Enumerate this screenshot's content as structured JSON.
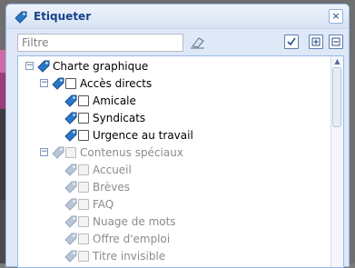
{
  "dialog": {
    "title": "Etiqueter",
    "close_symbol": "×"
  },
  "toolbar": {
    "filter_placeholder": "Filtre",
    "check_all_symbol": "✓",
    "expand_all_symbol": "+",
    "collapse_all_symbol": "−"
  },
  "tree": {
    "nodes": [
      {
        "label": "Charte graphique",
        "level": 0,
        "expander": "−",
        "enabled": true
      },
      {
        "label": "Accès directs",
        "level": 1,
        "expander": "−",
        "enabled": true
      },
      {
        "label": "Amicale",
        "level": 2,
        "enabled": true
      },
      {
        "label": "Syndicats",
        "level": 2,
        "enabled": true
      },
      {
        "label": "Urgence au travail",
        "level": 2,
        "enabled": true
      },
      {
        "label": "Contenus spéciaux",
        "level": 1,
        "expander": "−",
        "enabled": false
      },
      {
        "label": "Accueil",
        "level": 2,
        "enabled": false
      },
      {
        "label": "Brèves",
        "level": 2,
        "enabled": false
      },
      {
        "label": "FAQ",
        "level": 2,
        "enabled": false
      },
      {
        "label": "Nuage de mots",
        "level": 2,
        "enabled": false
      },
      {
        "label": "Offre d'emploi",
        "level": 2,
        "enabled": false
      },
      {
        "label": "Titre invisible",
        "level": 2,
        "enabled": false
      }
    ]
  },
  "colors": {
    "accent_title": "#15428b",
    "frame": "#99bbe8",
    "tag_blue": "#2a78c8",
    "tag_disabled": "#b7c6d8"
  }
}
